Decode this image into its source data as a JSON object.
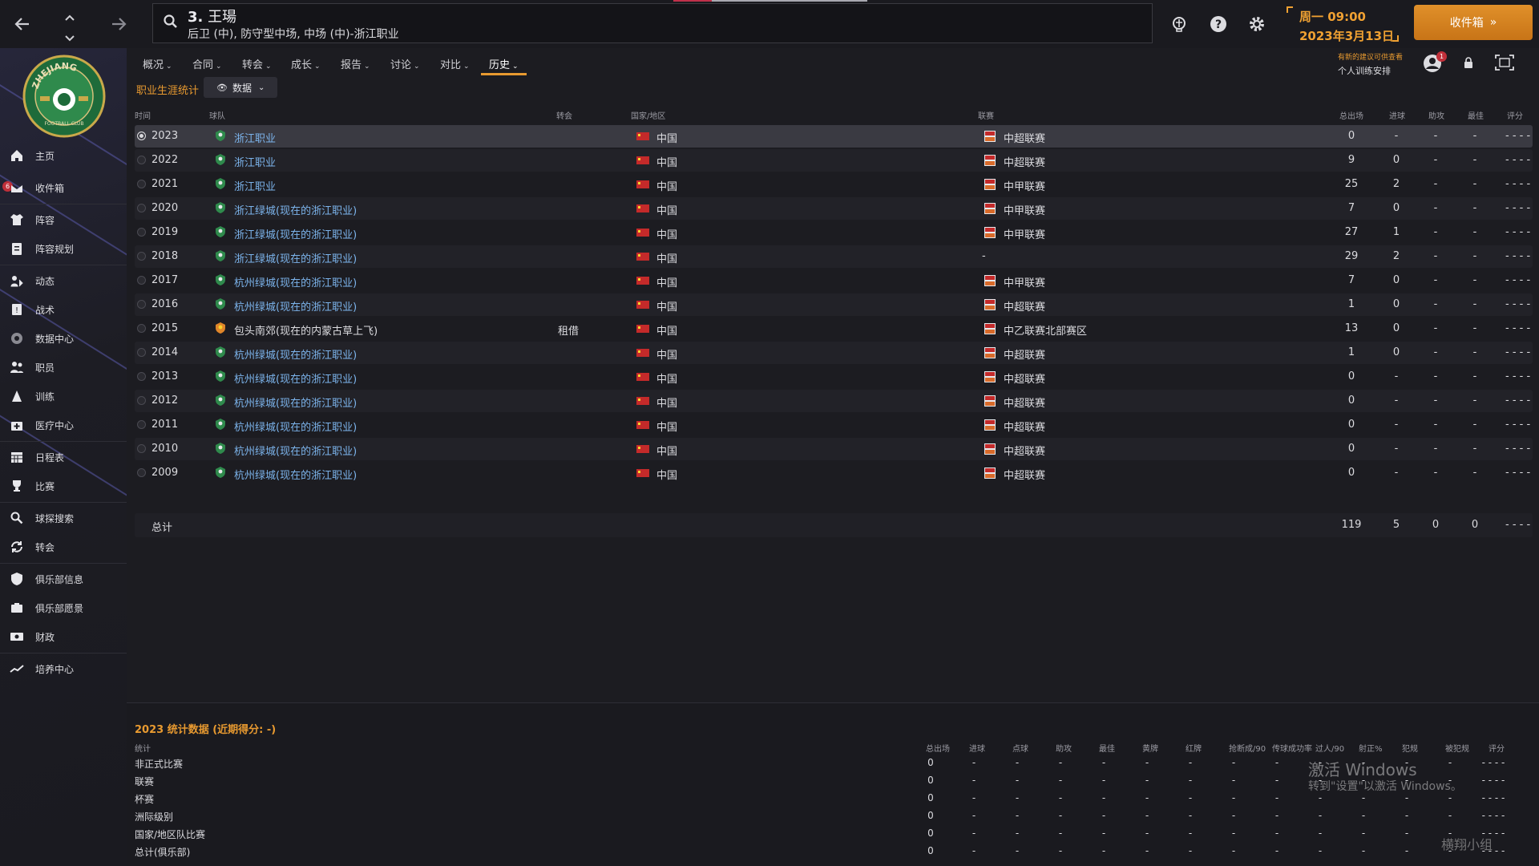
{
  "header": {
    "player_number": "3.",
    "player_name": "王瑒",
    "player_positions": "后卫 (中), 防守型中场, 中场 (中)-浙江职业",
    "date_line1": "周一 09:00",
    "date_line2": "2023年3月13日",
    "continue_label": "收件箱",
    "continue_arrows": "»"
  },
  "sidebar": {
    "inbox_badge": "6",
    "items": [
      {
        "label": "主页",
        "icon": "home-icon"
      },
      {
        "label": "收件箱",
        "icon": "inbox-icon"
      },
      {
        "label": "阵容",
        "icon": "shirt-icon"
      },
      {
        "label": "阵容规划",
        "icon": "clipboard-icon"
      },
      {
        "label": "动态",
        "icon": "dynamics-icon"
      },
      {
        "label": "战术",
        "icon": "tactics-icon"
      },
      {
        "label": "数据中心",
        "icon": "data-hub-icon"
      },
      {
        "label": "职员",
        "icon": "staff-icon"
      },
      {
        "label": "训练",
        "icon": "training-icon"
      },
      {
        "label": "医疗中心",
        "icon": "medical-icon"
      },
      {
        "label": "日程表",
        "icon": "calendar-icon"
      },
      {
        "label": "比赛",
        "icon": "trophy-icon"
      },
      {
        "label": "球探搜索",
        "icon": "scouting-icon"
      },
      {
        "label": "转会",
        "icon": "transfer-icon"
      },
      {
        "label": "俱乐部信息",
        "icon": "shield-icon"
      },
      {
        "label": "俱乐部愿景",
        "icon": "vision-icon"
      },
      {
        "label": "财政",
        "icon": "finance-icon"
      },
      {
        "label": "培养中心",
        "icon": "development-icon"
      }
    ]
  },
  "tabs": [
    {
      "label": "概况"
    },
    {
      "label": "合同"
    },
    {
      "label": "转会"
    },
    {
      "label": "成长"
    },
    {
      "label": "报告"
    },
    {
      "label": "讨论"
    },
    {
      "label": "对比"
    },
    {
      "label": "历史"
    }
  ],
  "notice": {
    "top": "有新的建议可供查看",
    "bottom": "个人训练安排",
    "badge": "1"
  },
  "section": {
    "title": "职业生涯统计",
    "view_label": "数据"
  },
  "career_table": {
    "headers": {
      "time": "时间",
      "club": "球队",
      "transfer": "转会",
      "nation": "国家/地区",
      "league": "联赛",
      "apps": "总出场",
      "goals": "进球",
      "assists": "助攻",
      "pom": "最佳",
      "rating": "评分"
    },
    "rows": [
      {
        "year": "2023",
        "club": "浙江职业",
        "transfer": "",
        "nation": "中国",
        "league": "中超联赛",
        "apps": "0",
        "goals": "-",
        "assists": "-",
        "pom": "-",
        "rating": "- - - -"
      },
      {
        "year": "2022",
        "club": "浙江职业",
        "transfer": "",
        "nation": "中国",
        "league": "中超联赛",
        "apps": "9",
        "goals": "0",
        "assists": "-",
        "pom": "-",
        "rating": "- - - -"
      },
      {
        "year": "2021",
        "club": "浙江职业",
        "transfer": "",
        "nation": "中国",
        "league": "中甲联赛",
        "apps": "25",
        "goals": "2",
        "assists": "-",
        "pom": "-",
        "rating": "- - - -"
      },
      {
        "year": "2020",
        "club": "浙江绿城(现在的浙江职业)",
        "transfer": "",
        "nation": "中国",
        "league": "中甲联赛",
        "apps": "7",
        "goals": "0",
        "assists": "-",
        "pom": "-",
        "rating": "- - - -"
      },
      {
        "year": "2019",
        "club": "浙江绿城(现在的浙江职业)",
        "transfer": "",
        "nation": "中国",
        "league": "中甲联赛",
        "apps": "27",
        "goals": "1",
        "assists": "-",
        "pom": "-",
        "rating": "- - - -"
      },
      {
        "year": "2018",
        "club": "浙江绿城(现在的浙江职业)",
        "transfer": "",
        "nation": "中国",
        "league": "-",
        "apps": "29",
        "goals": "2",
        "assists": "-",
        "pom": "-",
        "rating": "- - - -"
      },
      {
        "year": "2017",
        "club": "杭州绿城(现在的浙江职业)",
        "transfer": "",
        "nation": "中国",
        "league": "中甲联赛",
        "apps": "7",
        "goals": "0",
        "assists": "-",
        "pom": "-",
        "rating": "- - - -"
      },
      {
        "year": "2016",
        "club": "杭州绿城(现在的浙江职业)",
        "transfer": "",
        "nation": "中国",
        "league": "中超联赛",
        "apps": "1",
        "goals": "0",
        "assists": "-",
        "pom": "-",
        "rating": "- - - -"
      },
      {
        "year": "2015",
        "club": "包头南郊(现在的内蒙古草上飞)",
        "transfer": "租借",
        "nation": "中国",
        "league": "中乙联赛北部赛区",
        "apps": "13",
        "goals": "0",
        "assists": "-",
        "pom": "-",
        "rating": "- - - -"
      },
      {
        "year": "2014",
        "club": "杭州绿城(现在的浙江职业)",
        "transfer": "",
        "nation": "中国",
        "league": "中超联赛",
        "apps": "1",
        "goals": "0",
        "assists": "-",
        "pom": "-",
        "rating": "- - - -"
      },
      {
        "year": "2013",
        "club": "杭州绿城(现在的浙江职业)",
        "transfer": "",
        "nation": "中国",
        "league": "中超联赛",
        "apps": "0",
        "goals": "-",
        "assists": "-",
        "pom": "-",
        "rating": "- - - -"
      },
      {
        "year": "2012",
        "club": "杭州绿城(现在的浙江职业)",
        "transfer": "",
        "nation": "中国",
        "league": "中超联赛",
        "apps": "0",
        "goals": "-",
        "assists": "-",
        "pom": "-",
        "rating": "- - - -"
      },
      {
        "year": "2011",
        "club": "杭州绿城(现在的浙江职业)",
        "transfer": "",
        "nation": "中国",
        "league": "中超联赛",
        "apps": "0",
        "goals": "-",
        "assists": "-",
        "pom": "-",
        "rating": "- - - -"
      },
      {
        "year": "2010",
        "club": "杭州绿城(现在的浙江职业)",
        "transfer": "",
        "nation": "中国",
        "league": "中超联赛",
        "apps": "0",
        "goals": "-",
        "assists": "-",
        "pom": "-",
        "rating": "- - - -"
      },
      {
        "year": "2009",
        "club": "杭州绿城(现在的浙江职业)",
        "transfer": "",
        "nation": "中国",
        "league": "中超联赛",
        "apps": "0",
        "goals": "-",
        "assists": "-",
        "pom": "-",
        "rating": "- - - -"
      }
    ],
    "total": {
      "label": "总计",
      "apps": "119",
      "goals": "5",
      "assists": "0",
      "pom": "0",
      "rating": "- - - -"
    }
  },
  "season_stats": {
    "title": "2023 统计数据 (近期得分: -)",
    "category_header": "统计",
    "headers": [
      "总出场",
      "进球",
      "点球",
      "助攻",
      "最佳",
      "黄牌",
      "红牌",
      "抢断成/90",
      "传球成功率",
      "过人/90",
      "射正%",
      "犯规",
      "被犯规",
      "评分"
    ],
    "rows": [
      {
        "label": "非正式比赛",
        "apps": "0"
      },
      {
        "label": "联赛",
        "apps": "0"
      },
      {
        "label": "杯赛",
        "apps": "0"
      },
      {
        "label": "洲际级别",
        "apps": "0"
      },
      {
        "label": "国家/地区队比赛",
        "apps": "0"
      },
      {
        "label": "总计(俱乐部)",
        "apps": "0"
      }
    ],
    "dash": "-",
    "rating_dash": "- - - -"
  },
  "overlay": {
    "activate_title": "激活 Windows",
    "activate_sub": "转到\"设置\"以激活 Windows。",
    "watermark": "横翔小组"
  },
  "colors": {
    "accent": "#e89a30",
    "link": "#7cb4ec",
    "background": "#1c1c21"
  }
}
